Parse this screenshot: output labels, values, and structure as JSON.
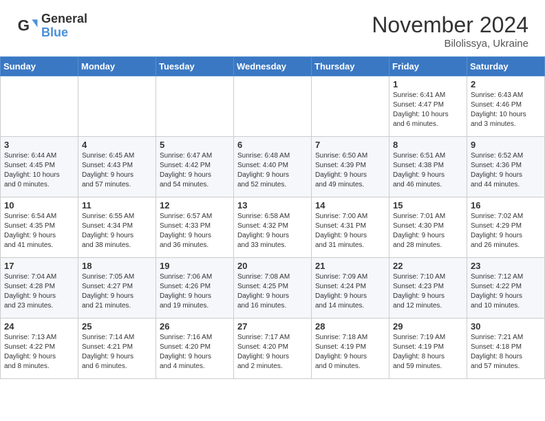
{
  "header": {
    "logo_general": "General",
    "logo_blue": "Blue",
    "month_title": "November 2024",
    "location": "Bilolissya, Ukraine"
  },
  "weekdays": [
    "Sunday",
    "Monday",
    "Tuesday",
    "Wednesday",
    "Thursday",
    "Friday",
    "Saturday"
  ],
  "weeks": [
    [
      {
        "day": "",
        "info": ""
      },
      {
        "day": "",
        "info": ""
      },
      {
        "day": "",
        "info": ""
      },
      {
        "day": "",
        "info": ""
      },
      {
        "day": "",
        "info": ""
      },
      {
        "day": "1",
        "info": "Sunrise: 6:41 AM\nSunset: 4:47 PM\nDaylight: 10 hours\nand 6 minutes."
      },
      {
        "day": "2",
        "info": "Sunrise: 6:43 AM\nSunset: 4:46 PM\nDaylight: 10 hours\nand 3 minutes."
      }
    ],
    [
      {
        "day": "3",
        "info": "Sunrise: 6:44 AM\nSunset: 4:45 PM\nDaylight: 10 hours\nand 0 minutes."
      },
      {
        "day": "4",
        "info": "Sunrise: 6:45 AM\nSunset: 4:43 PM\nDaylight: 9 hours\nand 57 minutes."
      },
      {
        "day": "5",
        "info": "Sunrise: 6:47 AM\nSunset: 4:42 PM\nDaylight: 9 hours\nand 54 minutes."
      },
      {
        "day": "6",
        "info": "Sunrise: 6:48 AM\nSunset: 4:40 PM\nDaylight: 9 hours\nand 52 minutes."
      },
      {
        "day": "7",
        "info": "Sunrise: 6:50 AM\nSunset: 4:39 PM\nDaylight: 9 hours\nand 49 minutes."
      },
      {
        "day": "8",
        "info": "Sunrise: 6:51 AM\nSunset: 4:38 PM\nDaylight: 9 hours\nand 46 minutes."
      },
      {
        "day": "9",
        "info": "Sunrise: 6:52 AM\nSunset: 4:36 PM\nDaylight: 9 hours\nand 44 minutes."
      }
    ],
    [
      {
        "day": "10",
        "info": "Sunrise: 6:54 AM\nSunset: 4:35 PM\nDaylight: 9 hours\nand 41 minutes."
      },
      {
        "day": "11",
        "info": "Sunrise: 6:55 AM\nSunset: 4:34 PM\nDaylight: 9 hours\nand 38 minutes."
      },
      {
        "day": "12",
        "info": "Sunrise: 6:57 AM\nSunset: 4:33 PM\nDaylight: 9 hours\nand 36 minutes."
      },
      {
        "day": "13",
        "info": "Sunrise: 6:58 AM\nSunset: 4:32 PM\nDaylight: 9 hours\nand 33 minutes."
      },
      {
        "day": "14",
        "info": "Sunrise: 7:00 AM\nSunset: 4:31 PM\nDaylight: 9 hours\nand 31 minutes."
      },
      {
        "day": "15",
        "info": "Sunrise: 7:01 AM\nSunset: 4:30 PM\nDaylight: 9 hours\nand 28 minutes."
      },
      {
        "day": "16",
        "info": "Sunrise: 7:02 AM\nSunset: 4:29 PM\nDaylight: 9 hours\nand 26 minutes."
      }
    ],
    [
      {
        "day": "17",
        "info": "Sunrise: 7:04 AM\nSunset: 4:28 PM\nDaylight: 9 hours\nand 23 minutes."
      },
      {
        "day": "18",
        "info": "Sunrise: 7:05 AM\nSunset: 4:27 PM\nDaylight: 9 hours\nand 21 minutes."
      },
      {
        "day": "19",
        "info": "Sunrise: 7:06 AM\nSunset: 4:26 PM\nDaylight: 9 hours\nand 19 minutes."
      },
      {
        "day": "20",
        "info": "Sunrise: 7:08 AM\nSunset: 4:25 PM\nDaylight: 9 hours\nand 16 minutes."
      },
      {
        "day": "21",
        "info": "Sunrise: 7:09 AM\nSunset: 4:24 PM\nDaylight: 9 hours\nand 14 minutes."
      },
      {
        "day": "22",
        "info": "Sunrise: 7:10 AM\nSunset: 4:23 PM\nDaylight: 9 hours\nand 12 minutes."
      },
      {
        "day": "23",
        "info": "Sunrise: 7:12 AM\nSunset: 4:22 PM\nDaylight: 9 hours\nand 10 minutes."
      }
    ],
    [
      {
        "day": "24",
        "info": "Sunrise: 7:13 AM\nSunset: 4:22 PM\nDaylight: 9 hours\nand 8 minutes."
      },
      {
        "day": "25",
        "info": "Sunrise: 7:14 AM\nSunset: 4:21 PM\nDaylight: 9 hours\nand 6 minutes."
      },
      {
        "day": "26",
        "info": "Sunrise: 7:16 AM\nSunset: 4:20 PM\nDaylight: 9 hours\nand 4 minutes."
      },
      {
        "day": "27",
        "info": "Sunrise: 7:17 AM\nSunset: 4:20 PM\nDaylight: 9 hours\nand 2 minutes."
      },
      {
        "day": "28",
        "info": "Sunrise: 7:18 AM\nSunset: 4:19 PM\nDaylight: 9 hours\nand 0 minutes."
      },
      {
        "day": "29",
        "info": "Sunrise: 7:19 AM\nSunset: 4:19 PM\nDaylight: 8 hours\nand 59 minutes."
      },
      {
        "day": "30",
        "info": "Sunrise: 7:21 AM\nSunset: 4:18 PM\nDaylight: 8 hours\nand 57 minutes."
      }
    ]
  ]
}
